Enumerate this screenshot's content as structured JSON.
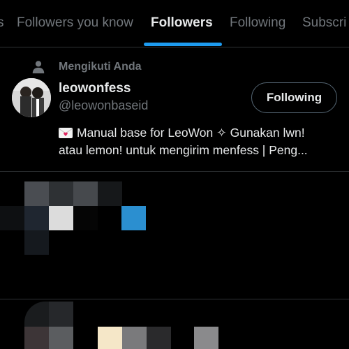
{
  "tabs": [
    {
      "label": "s"
    },
    {
      "label": "Followers you know"
    },
    {
      "label": "Followers"
    },
    {
      "label": "Following"
    },
    {
      "label": "Subscri"
    }
  ],
  "active_tab": "Followers",
  "user": {
    "follows_you_label": "Mengikuti Anda",
    "display_name": "leowonfess",
    "handle": "@leowonbaseid",
    "button_label": "Following",
    "bio_line_1": "Manual base for LeoWon ✧ Gunakan lwn!",
    "bio_line_2": "atau lemon! untuk mengirim menfess | Peng..."
  },
  "colors": {
    "background": "#000000",
    "accent": "#1d9bf0",
    "primary_text": "#e7e9ea",
    "secondary_text": "#71767b",
    "divider": "#2f3336"
  },
  "icons": {
    "follows_you": "person-icon",
    "bio_emoji": "love-letter-icon"
  }
}
